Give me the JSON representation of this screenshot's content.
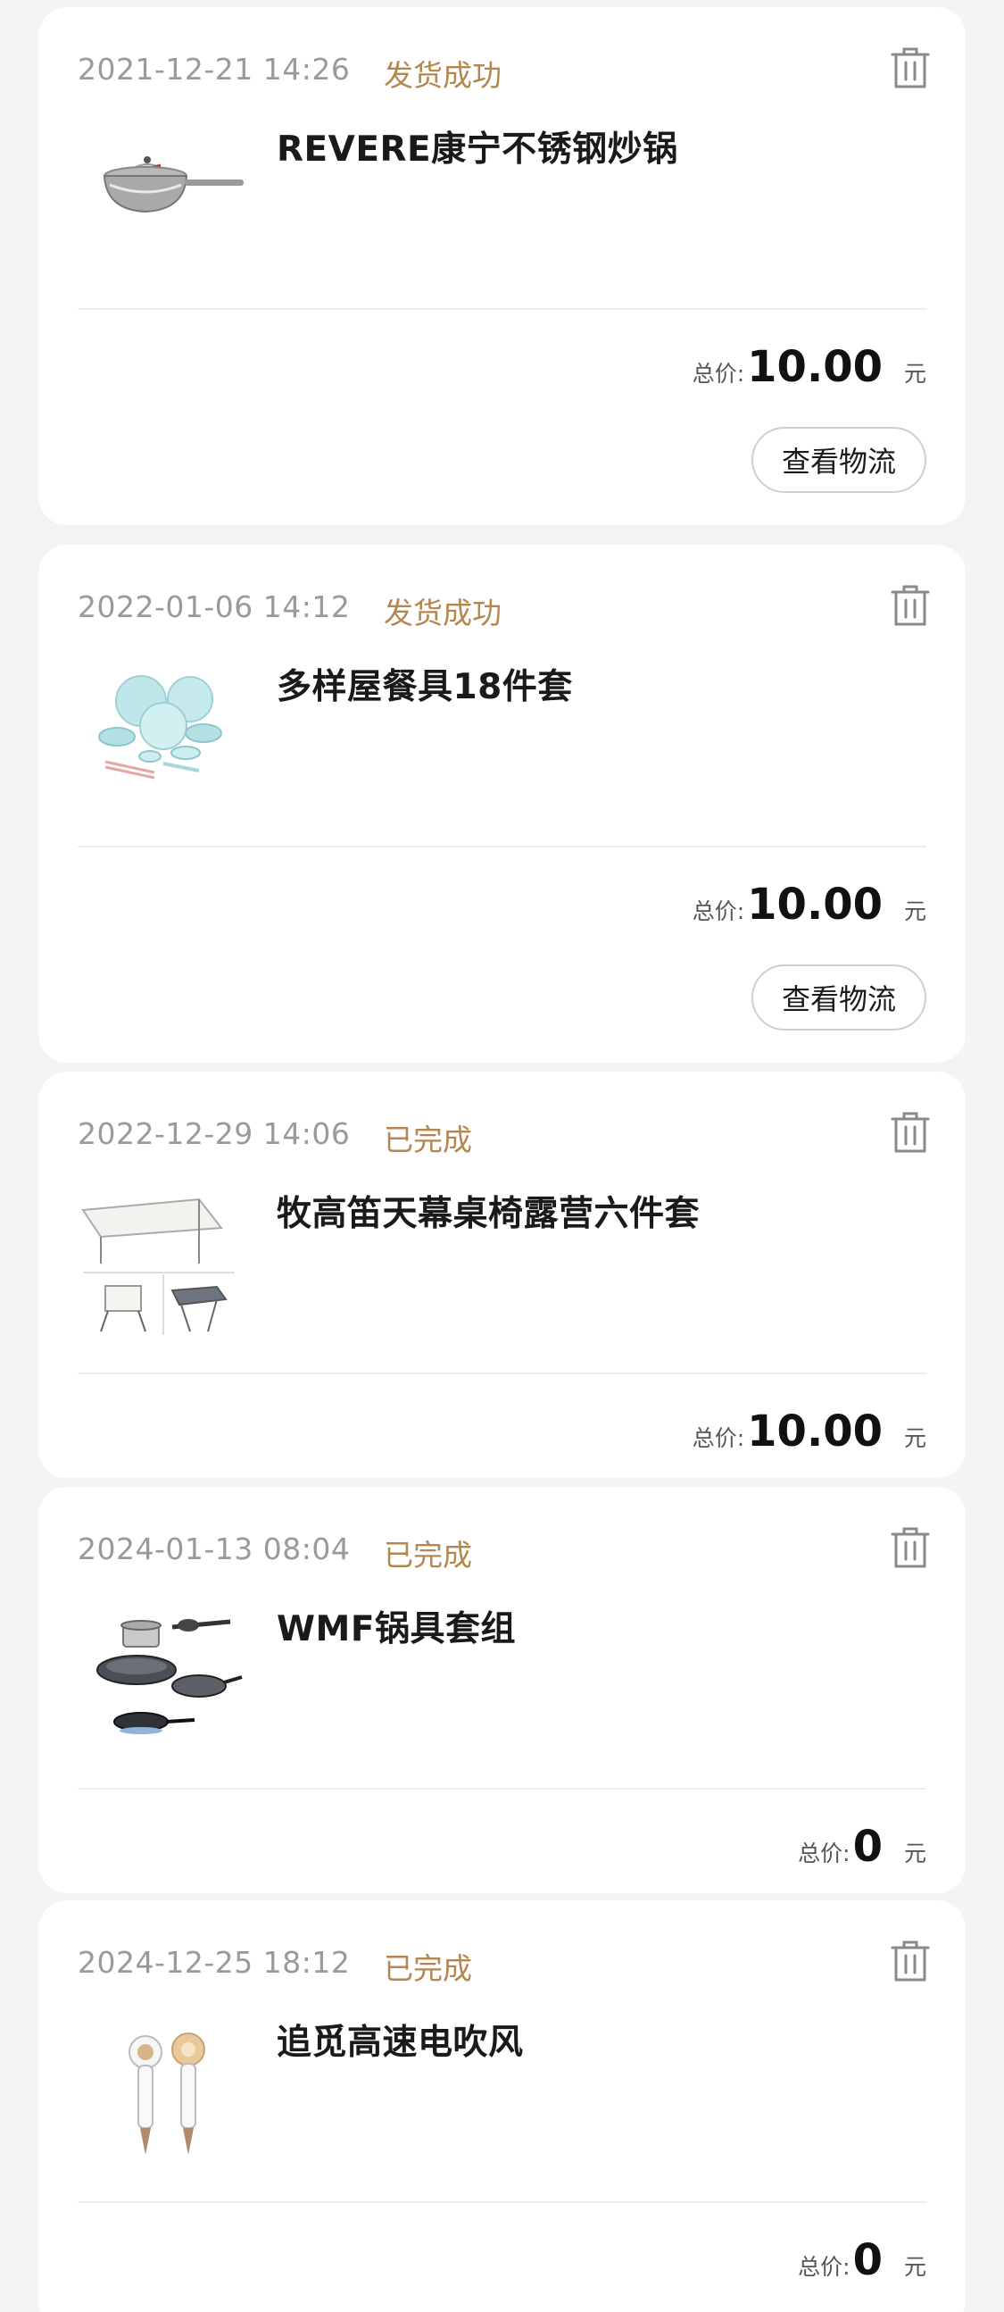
{
  "orders": [
    {
      "date": "2021-12-21 14:26",
      "status": "发货成功",
      "title": "REVERE康宁不锈钢炒锅",
      "price_label": "总价",
      "price_colon": ":",
      "price": "10.00",
      "unit": "元",
      "button_label": "查看物流",
      "image": "stainless-wok"
    },
    {
      "date": "2022-01-06 14:12",
      "status": "发货成功",
      "title": "多样屋餐具18件套",
      "price_label": "总价",
      "price_colon": ":",
      "price": "10.00",
      "unit": "元",
      "button_label": "查看物流",
      "image": "tableware-set"
    },
    {
      "date": "2022-12-29 14:06",
      "status": "已完成",
      "title": "牧高笛天幕桌椅露营六件套",
      "price_label": "总价",
      "price_colon": ":",
      "price": "10.00",
      "unit": "元",
      "image": "camping-set"
    },
    {
      "date": "2024-01-13 08:04",
      "status": "已完成",
      "title": "WMF锅具套组",
      "price_label": "总价",
      "price_colon": ":",
      "price": "0",
      "unit": "元",
      "image": "cookware-set"
    },
    {
      "date": "2024-12-25 18:12",
      "status": "已完成",
      "title": "追觅高速电吹风",
      "price_label": "总价",
      "price_colon": ":",
      "price": "0",
      "unit": "元",
      "image": "hair-dryer"
    }
  ],
  "colors": {
    "status": "#b3874f",
    "date": "#9a9a9a",
    "title": "#1a1a1a"
  },
  "icons": {
    "delete": "trash-icon"
  }
}
